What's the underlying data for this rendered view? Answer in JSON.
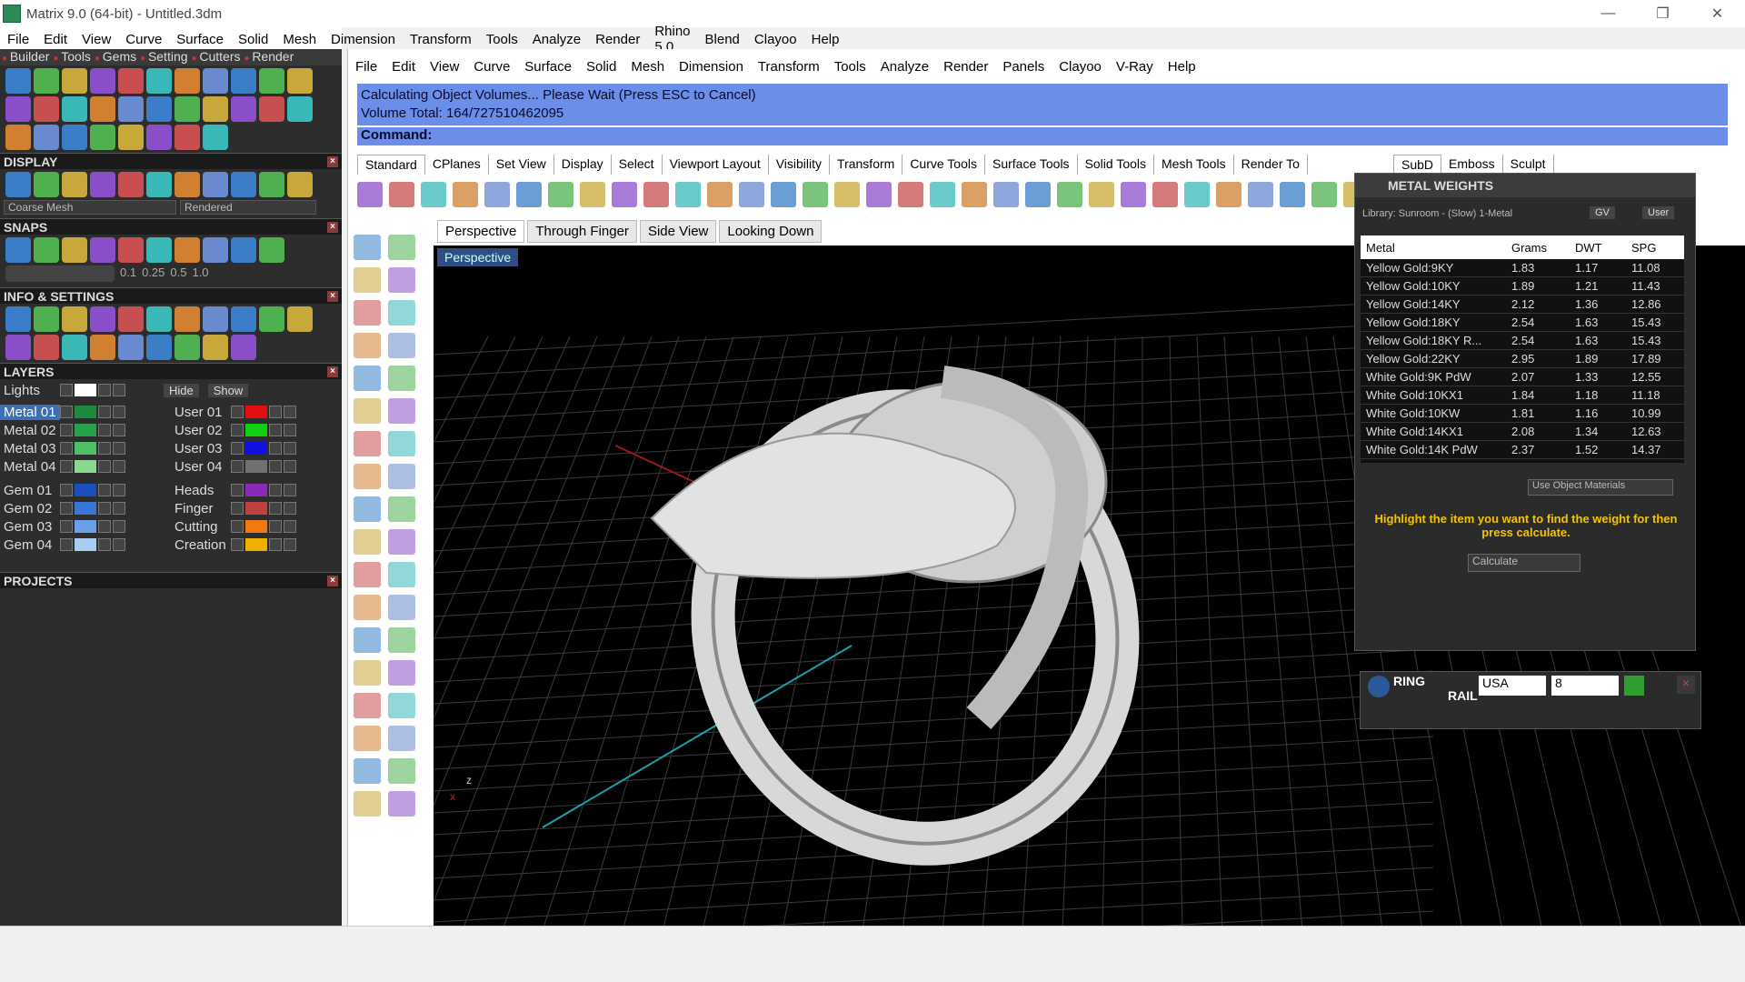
{
  "app": {
    "title": "Matrix 9.0 (64-bit) - Untitled.3dm"
  },
  "menu": [
    "File",
    "Edit",
    "View",
    "Curve",
    "Surface",
    "Solid",
    "Mesh",
    "Dimension",
    "Transform",
    "Tools",
    "Analyze",
    "Render",
    "Rhino 5.0",
    "Blend",
    "Clayoo",
    "Help"
  ],
  "left_tabs": [
    "Builder",
    "Tools",
    "Gems",
    "Setting",
    "Cutters",
    "Render"
  ],
  "display": {
    "title": "DISPLAY",
    "mesh": "Coarse Mesh",
    "render": "Rendered"
  },
  "snaps": {
    "title": "SNAPS",
    "values": [
      "0.1",
      "0.25",
      "0.5",
      "1.0"
    ]
  },
  "info": {
    "title": "INFO & SETTINGS"
  },
  "layers": {
    "title": "LAYERS",
    "lights": "Lights",
    "hide": "Hide",
    "show": "Show",
    "left": [
      {
        "name": "Metal 01",
        "color": "#1e8a3c"
      },
      {
        "name": "Metal 02",
        "color": "#25a34a"
      },
      {
        "name": "Metal 03",
        "color": "#4cc064"
      },
      {
        "name": "Metal 04",
        "color": "#8ad88f"
      },
      {
        "name": "Gem 01",
        "color": "#1e4fbf"
      },
      {
        "name": "Gem 02",
        "color": "#3a76d8"
      },
      {
        "name": "Gem 03",
        "color": "#6aa0ea"
      },
      {
        "name": "Gem 04",
        "color": "#a8cdf4"
      }
    ],
    "right": [
      {
        "name": "User 01",
        "color": "#e01010"
      },
      {
        "name": "User 02",
        "color": "#10d010"
      },
      {
        "name": "User 03",
        "color": "#1010e0"
      },
      {
        "name": "User 04",
        "color": "#707070"
      },
      {
        "name": "Heads",
        "color": "#8a2ab8"
      },
      {
        "name": "Finger",
        "color": "#c04040"
      },
      {
        "name": "Cutting",
        "color": "#f07a10"
      },
      {
        "name": "Creation",
        "color": "#f0b000"
      }
    ]
  },
  "projects": {
    "title": "PROJECTS"
  },
  "rhino_menu": [
    "File",
    "Edit",
    "View",
    "Curve",
    "Surface",
    "Solid",
    "Mesh",
    "Dimension",
    "Transform",
    "Tools",
    "Analyze",
    "Render",
    "Panels",
    "Clayoo",
    "V-Ray",
    "Help"
  ],
  "command": {
    "line1": "Calculating Object Volumes... Please Wait (Press ESC to Cancel)",
    "line2": "Volume Total: 164/727510462095",
    "prompt": "Command:"
  },
  "toolbar_tabs": [
    "Standard",
    "CPlanes",
    "Set View",
    "Display",
    "Select",
    "Viewport Layout",
    "Visibility",
    "Transform",
    "Curve Tools",
    "Surface Tools",
    "Solid Tools",
    "Mesh Tools",
    "Render To"
  ],
  "right_tabs": [
    "SubD",
    "Emboss",
    "Sculpt"
  ],
  "viewport_tabs": [
    "Perspective",
    "Through Finger",
    "Side View",
    "Looking Down"
  ],
  "viewport_label": "Perspective",
  "metal_weights": {
    "title": "METAL WEIGHTS",
    "library": "Library: Sunroom - (Slow) 1-Metal",
    "gv": "GV",
    "user": "User",
    "headers": [
      "Metal",
      "Grams",
      "DWT",
      "SPG"
    ],
    "rows": [
      [
        "Yellow Gold:9KY",
        "1.83",
        "1.17",
        "11.08"
      ],
      [
        "Yellow Gold:10KY",
        "1.89",
        "1.21",
        "11.43"
      ],
      [
        "Yellow Gold:14KY",
        "2.12",
        "1.36",
        "12.86"
      ],
      [
        "Yellow Gold:18KY",
        "2.54",
        "1.63",
        "15.43"
      ],
      [
        "Yellow Gold:18KY R...",
        "2.54",
        "1.63",
        "15.43"
      ],
      [
        "Yellow Gold:22KY",
        "2.95",
        "1.89",
        "17.89"
      ],
      [
        "White Gold:9K PdW",
        "2.07",
        "1.33",
        "12.55"
      ],
      [
        "White Gold:10KX1",
        "1.84",
        "1.18",
        "11.18"
      ],
      [
        "White Gold:10KW",
        "1.81",
        "1.16",
        "10.99"
      ],
      [
        "White Gold:14KX1",
        "2.08",
        "1.34",
        "12.63"
      ],
      [
        "White Gold:14K PdW",
        "2.37",
        "1.52",
        "14.37"
      ]
    ],
    "use_obj": "Use Object Materials",
    "hint": "Highlight the item you want to find the weight for then press calculate.",
    "calc": "Calculate"
  },
  "ring_rail": {
    "title1": "RING",
    "title2": "RAIL",
    "country": "USA",
    "size": "8"
  }
}
